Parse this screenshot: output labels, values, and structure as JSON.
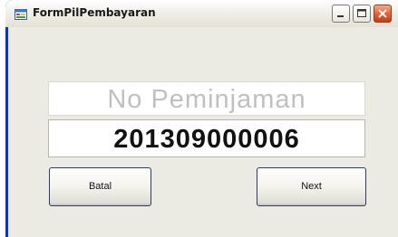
{
  "window": {
    "title": "FormPilPembayaran",
    "icon": "form-app-icon",
    "controls": [
      "minimize-icon",
      "maximize-icon",
      "close-icon"
    ]
  },
  "form": {
    "label_text": "No Peminjaman",
    "value_text": "201309000006",
    "buttons": {
      "batal_label": "Batal",
      "next_label": "Next"
    }
  },
  "colors": {
    "title_bar": "#e8e6dc",
    "frame": "#0831d9",
    "client_bg": "#ebeae3",
    "placeholder_text": "#c0c0c0"
  }
}
